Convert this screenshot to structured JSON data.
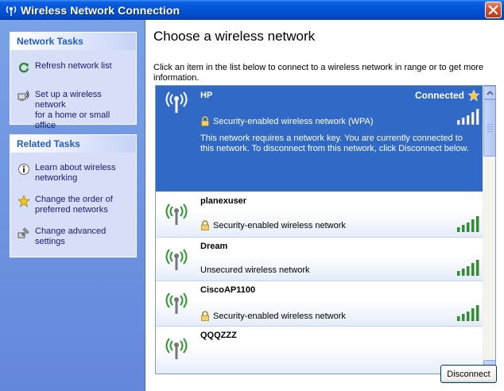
{
  "window": {
    "title": "Wireless Network Connection",
    "icons": {
      "app": "wireless-antenna-icon",
      "close": "close-icon"
    },
    "colors": {
      "titlebar": "#0353d6",
      "close": "#d4512c"
    }
  },
  "sidebar": {
    "network_tasks": {
      "title": "Network Tasks",
      "items": [
        {
          "label_line1": "Refresh network list",
          "label_line2": "",
          "icon": "refresh-icon"
        },
        {
          "label_line1": "Set up a wireless network",
          "label_line2": "for a home or small office",
          "icon": "setup-network-icon"
        }
      ]
    },
    "related_tasks": {
      "title": "Related Tasks",
      "items": [
        {
          "label_line1": "Learn about wireless",
          "label_line2": "networking",
          "icon": "info-icon"
        },
        {
          "label_line1": "Change the order of",
          "label_line2": "preferred networks",
          "icon": "star-icon"
        },
        {
          "label_line1": "Change advanced",
          "label_line2": "settings",
          "icon": "settings-icon"
        }
      ]
    }
  },
  "main": {
    "heading": "Choose a wireless network",
    "instructions": "Click an item in the list below to connect to a wireless network in range or to get more information.",
    "networks": [
      {
        "ssid": "HP",
        "status": "Connected",
        "security": "Security-enabled wireless network (WPA)",
        "description": "This network requires a network key. You are currently connected to this network. To disconnect from this network, click Disconnect below.",
        "signal_bars": 5,
        "selected": true,
        "secured": true
      },
      {
        "ssid": "planexuser",
        "security": "Security-enabled wireless network",
        "signal_bars": 5,
        "selected": false,
        "secured": true
      },
      {
        "ssid": "Dream",
        "security": "Unsecured wireless network",
        "signal_bars": 5,
        "selected": false,
        "secured": false
      },
      {
        "ssid": "CiscoAP1100",
        "security": "Security-enabled wireless network",
        "signal_bars": 5,
        "selected": false,
        "secured": true
      },
      {
        "ssid": "QQQZZZ",
        "security": "",
        "signal_bars": 5,
        "selected": false,
        "secured": false
      }
    ],
    "disconnect_label": "Disconnect",
    "colors": {
      "selected_row": "#3169c6",
      "signal_green": "#2f8f2f"
    }
  }
}
